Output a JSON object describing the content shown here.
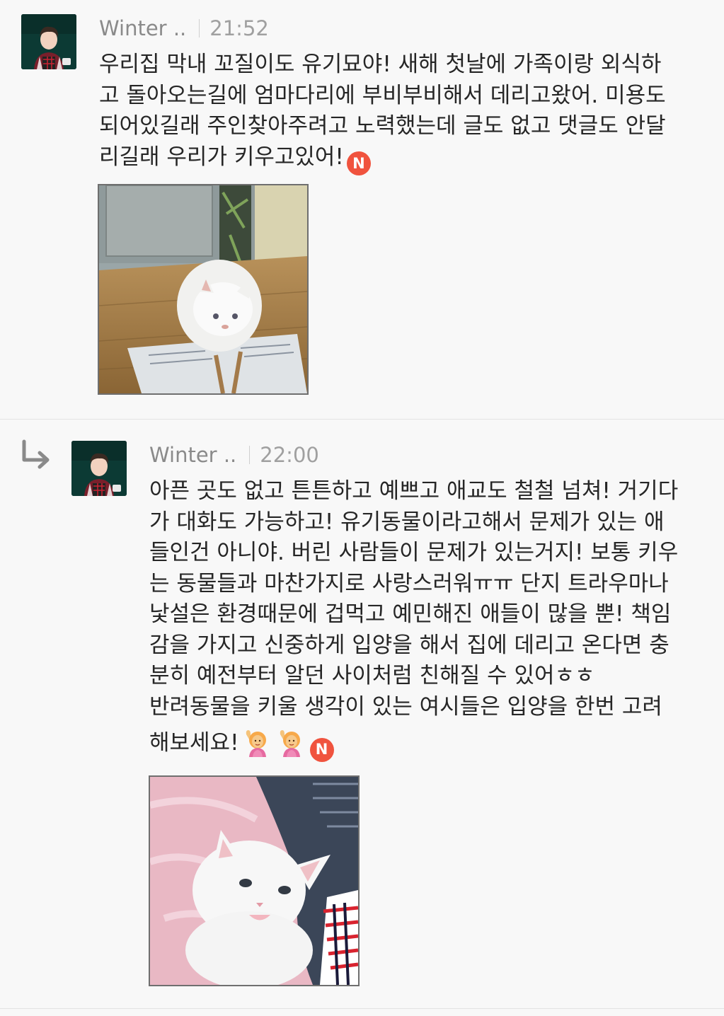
{
  "comments": [
    {
      "author": "Winter ..",
      "time": "21:52",
      "lines": [
        "우리집 막내 꼬질이도 유기묘야! 새해 첫날에 가족이랑 외식하",
        "고 돌아오는길에 엄마다리에 부비부비해서 데리고왔어. 미용도",
        "되어있길래 주인찾아주려고 노력했는데 글도 없고 댓글도 안달",
        "리길래 우리가 키우고있어!"
      ],
      "badge": "N",
      "photo_icon": "white-cat-on-newspaper-photo"
    },
    {
      "author": "Winter ..",
      "time": "22:00",
      "is_reply": true,
      "lines": [
        "아픈 곳도 없고 튼튼하고 예쁘고 애교도 철철 넘쳐! 거기다",
        "가 대화도 가능하고! 유기동물이라고해서 문제가 있는 애",
        "들인건 아니야. 버린 사람들이 문제가 있는거지! 보통 키우",
        "는 동물들과 마찬가지로 사랑스러워ㅠㅠ 단지 트라우마나",
        "낯설은 환경때문에 겁먹고 예민해진 애들이 많을 뿐! 책임",
        "감을 가지고 신중하게 입양을 해서 집에 데리고 온다면 충",
        "분히 예전부터 알던 사이처럼 친해질 수 있어ㅎㅎ",
        "반려동물을 키울 생각이 있는 여시들은 입양을 한번 고려",
        "해보세요!"
      ],
      "emojis": [
        "raising-hand-emoji",
        "raising-hand-emoji"
      ],
      "badge": "N",
      "photo_icon": "white-cat-on-pink-blanket-photo"
    }
  ],
  "colors": {
    "badge": "#f0533e",
    "background": "#f8f8f8"
  }
}
